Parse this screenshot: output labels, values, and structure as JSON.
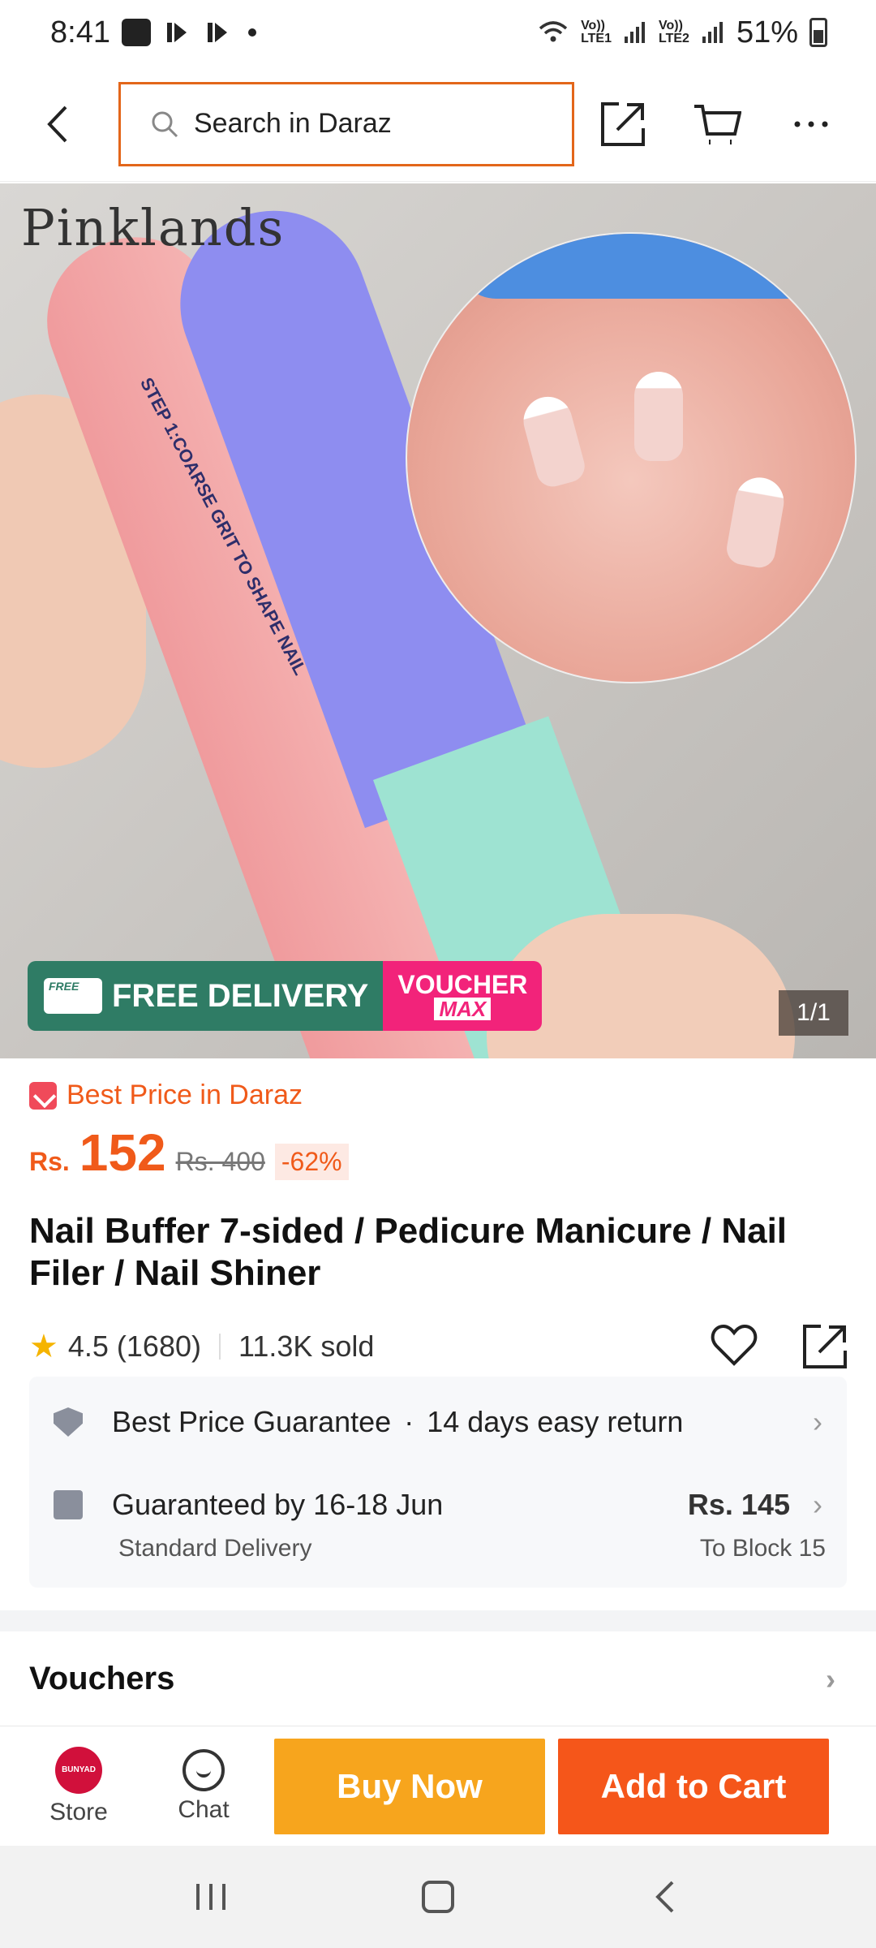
{
  "status_bar": {
    "time": "8:41",
    "net1": [
      "Vo))",
      "LTE1"
    ],
    "net2": [
      "Vo))",
      "LTE2"
    ],
    "battery": "51%"
  },
  "header": {
    "search_placeholder": "Search in Daraz",
    "icons": [
      "back-icon",
      "search-icon",
      "share-icon",
      "cart-icon",
      "more-icon"
    ]
  },
  "gallery": {
    "brand_overlay": "Pinklands",
    "file_step1_label": "STEP 1:COARSE GRIT TO SHAPE NAIL",
    "promo_free_delivery": "FREE DELIVERY",
    "promo_voucher_line1": "VOUCHER",
    "promo_voucher_line2": "MAX",
    "image_counter": "1/1"
  },
  "product": {
    "best_price_label": "Best Price in Daraz",
    "currency": "Rs.",
    "price": "152",
    "original_price": "Rs. 400",
    "discount": "-62%",
    "title": "Nail Buffer 7-sided / Pedicure Manicure / Nail Filer / Nail Shiner",
    "rating": "4.5",
    "rating_count": "(1680)",
    "sold": "11.3K sold"
  },
  "guarantees": {
    "best_price_guarantee": "Best Price Guarantee",
    "separator": "·",
    "easy_return": "14 days easy return",
    "delivery_date": "Guaranteed by 16-18 Jun",
    "delivery_type": "Standard Delivery",
    "delivery_fee": "Rs. 145",
    "delivery_location": "To Block 15"
  },
  "vouchers": {
    "title": "Vouchers"
  },
  "action_bar": {
    "store_logo_text": "BUNYAD",
    "store_label": "Store",
    "chat_label": "Chat",
    "buy_now_label": "Buy Now",
    "add_to_cart_label": "Add to Cart"
  },
  "colors": {
    "accent_orange": "#f05a1a",
    "buy_now": "#f7a51d",
    "add_to_cart": "#f5561a",
    "search_border": "#e3661a",
    "free_delivery_green": "#2f7c65",
    "voucher_pink": "#f2237a",
    "star": "#f5b400"
  }
}
